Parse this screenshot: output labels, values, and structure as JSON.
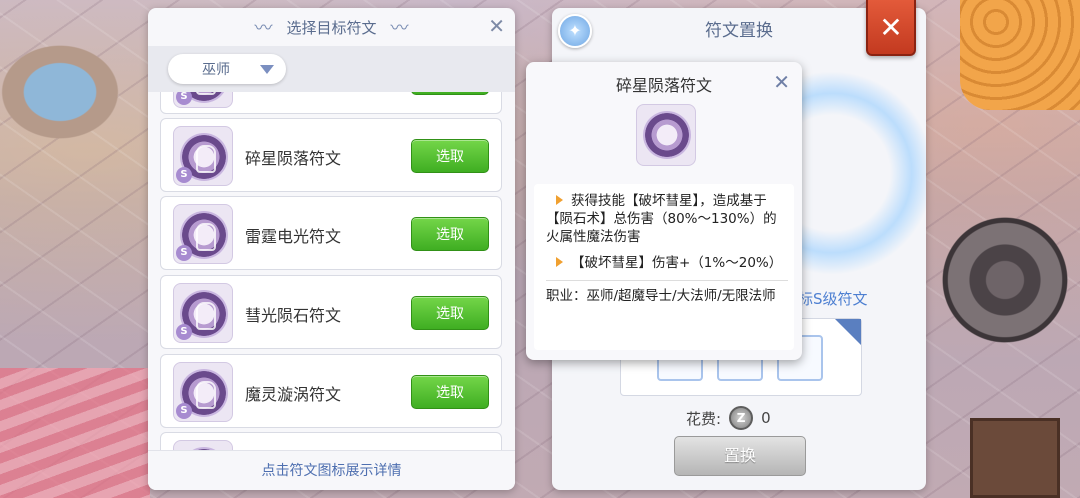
{
  "left_panel": {
    "title": "选择目标符文",
    "filter": {
      "selected": "巫师"
    },
    "runes": [
      {
        "name": "",
        "grade": "S",
        "button": "选取"
      },
      {
        "name": "碎星陨落符文",
        "grade": "S",
        "button": "选取"
      },
      {
        "name": "雷霆电光符文",
        "grade": "S",
        "button": "选取"
      },
      {
        "name": "彗光陨石符文",
        "grade": "S",
        "button": "选取"
      },
      {
        "name": "魔灵漩涡符文",
        "grade": "S",
        "button": "选取"
      },
      {
        "name": "",
        "grade": "S",
        "button": ""
      }
    ],
    "footer_hint": "点击符文图标展示详情"
  },
  "right_panel": {
    "title": "符文置换",
    "target_label": "标S级符文",
    "cost_label": "花费:",
    "cost_value": "0",
    "coin_glyph": "Z",
    "replace_button": "置换",
    "close_glyph": "✕"
  },
  "tooltip": {
    "title": "碎星陨落符文",
    "lines": [
      "获得技能【破坏彗星】，造成基于【陨石术】总伤害（80%～130%）的火属性魔法伤害",
      "【破坏彗星】伤害+（1%～20%）"
    ],
    "job": "职业：巫师/超魔导士/大法师/无限法师"
  }
}
